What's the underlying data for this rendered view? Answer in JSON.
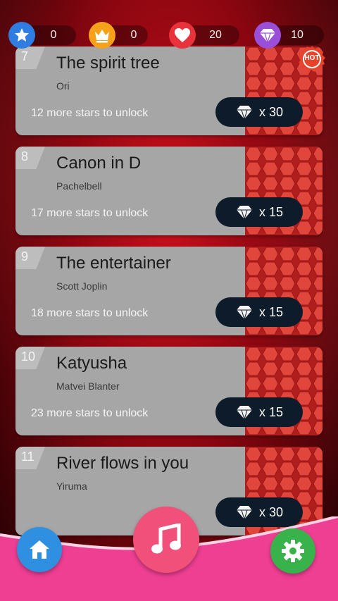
{
  "currency": {
    "stars": "0",
    "crowns": "0",
    "hearts": "20",
    "gems": "10"
  },
  "hot_badge": "HOT",
  "songs": [
    {
      "number": "7",
      "title": "The spirit tree",
      "artist": "Ori",
      "unlock_text": "12 more stars to unlock",
      "price": "x 30"
    },
    {
      "number": "8",
      "title": "Canon in D",
      "artist": "Pachelbell",
      "unlock_text": "17 more stars to unlock",
      "price": "x 15"
    },
    {
      "number": "9",
      "title": "The entertainer",
      "artist": "Scott Joplin",
      "unlock_text": "18 more stars to unlock",
      "price": "x 15"
    },
    {
      "number": "10",
      "title": "Katyusha",
      "artist": "Matvei Blanter",
      "unlock_text": "23 more stars to unlock",
      "price": "x 15"
    },
    {
      "number": "11",
      "title": "River flows in you",
      "artist": "Yiruma",
      "unlock_text": "",
      "price": "x 30"
    }
  ],
  "icons": {
    "star": "star-icon",
    "crown": "crown-icon",
    "heart": "heart-icon",
    "gem": "diamond-icon",
    "home": "home-icon",
    "music": "music-note-icon",
    "settings": "gear-icon"
  },
  "colors": {
    "star_blue": "#2f7de1",
    "crown_orange": "#f5a21a",
    "heart_red": "#e8323c",
    "gem_purple": "#9a4fd8",
    "card_gray": "#a6a6a6",
    "price_navy": "#0d1b2a",
    "music_pink": "#f0507a",
    "home_blue": "#2f8fe0",
    "settings_green": "#38b24a",
    "wave_pink": "#ef3f93"
  }
}
